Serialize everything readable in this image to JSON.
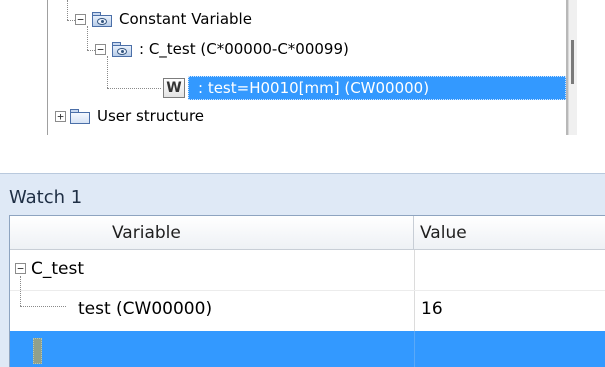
{
  "tree": {
    "constant_variable_label": "Constant Variable",
    "c_test_label": ": C_test (C*00000-C*00099)",
    "selected_badge": "W",
    "selected_item_label": ": test=H0010[mm] (CW00000)",
    "user_structure_label": "User structure",
    "expander_minus": "−",
    "expander_plus": "+"
  },
  "watch": {
    "title": "Watch 1",
    "columns": {
      "variable": "Variable",
      "value": "Value"
    },
    "rows": [
      {
        "variable": "C_test",
        "value": ""
      },
      {
        "variable": "test (CW00000)",
        "value": "16"
      }
    ],
    "expander_minus": "−"
  },
  "colors": {
    "selection": "#3399ff",
    "watch_frame": "#dfe9f6"
  }
}
